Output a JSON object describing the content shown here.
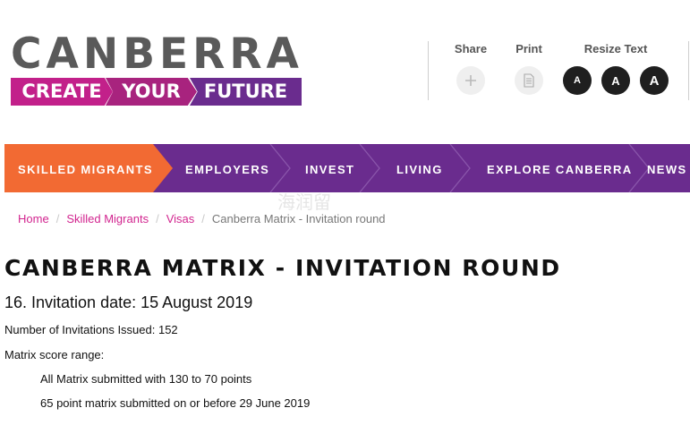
{
  "logo": {
    "word": "CANBERRA",
    "strip": [
      "CREATE",
      "YOUR",
      "FUTURE"
    ]
  },
  "tools": {
    "share_label": "Share",
    "print_label": "Print",
    "resize_label": "Resize Text",
    "resize_buttons": [
      "A",
      "A",
      "A"
    ],
    "share_icon": "plus-icon",
    "print_icon": "document-icon"
  },
  "nav": {
    "items": [
      "SKILLED MIGRANTS",
      "EMPLOYERS",
      "INVEST",
      "LIVING",
      "EXPLORE CANBERRA",
      "NEWS"
    ],
    "active_index": 0,
    "colors": {
      "bar": "#6a2c8e",
      "active": "#f26a33"
    }
  },
  "watermark": "海润留",
  "breadcrumb": {
    "items": [
      "Home",
      "Skilled Migrants",
      "Visas"
    ],
    "separator": "/",
    "current": "Canberra Matrix - Invitation round"
  },
  "content": {
    "title": "CANBERRA MATRIX - INVITATION ROUND",
    "subheading": "16. Invitation date: 15 August 2019",
    "invitations_issued": "Number of Invitations Issued: 152",
    "score_range_label": "Matrix score range:",
    "score_items": [
      "All Matrix submitted with 130 to 70 points",
      "65 point matrix submitted on or before 29 June 2019"
    ]
  },
  "colors": {
    "accent_pink": "#d2258f",
    "logo_grey": "#5a5a5a"
  }
}
